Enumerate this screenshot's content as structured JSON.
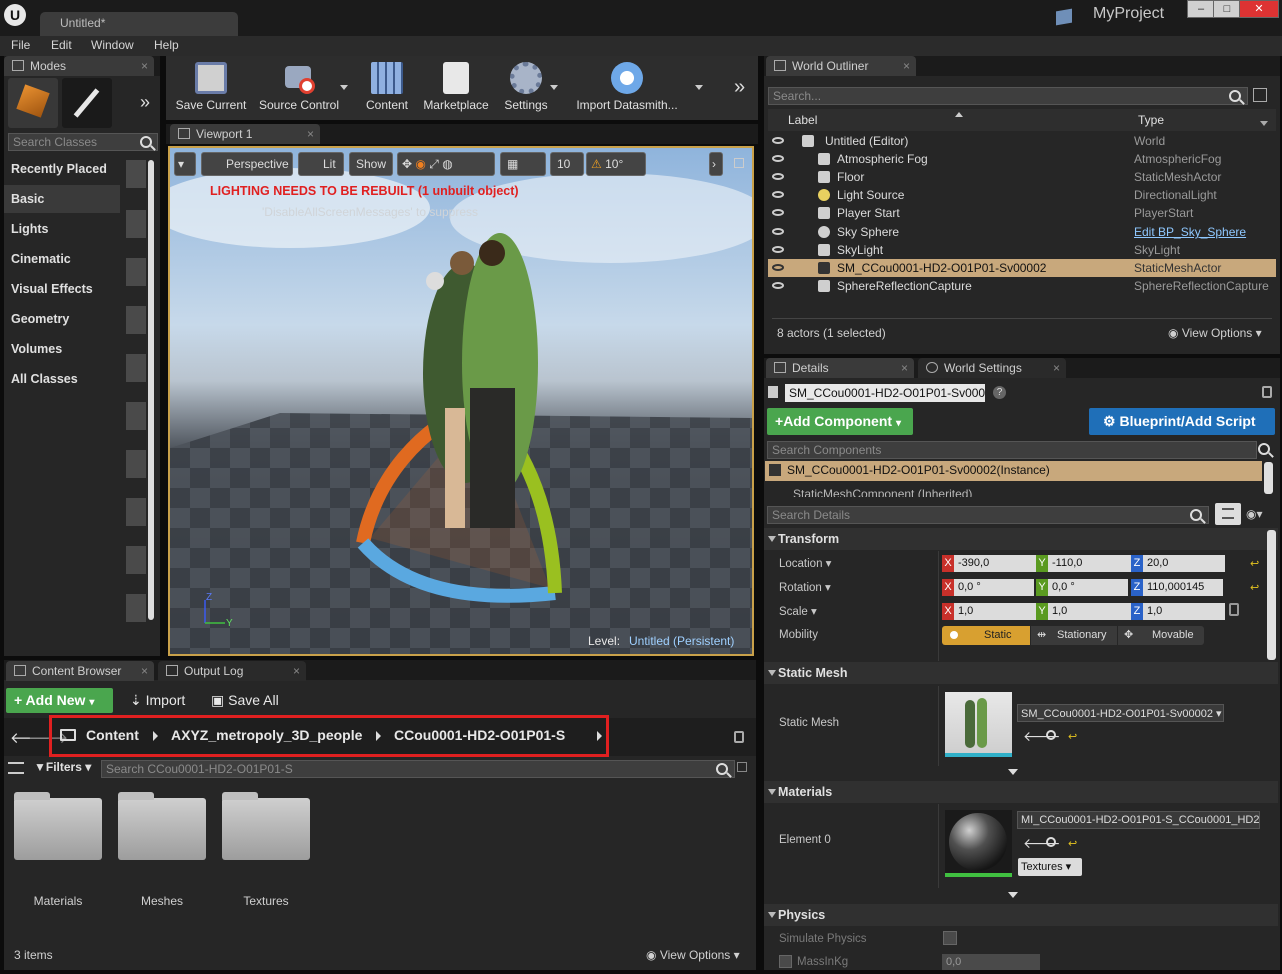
{
  "app": {
    "tab_title": "Untitled*",
    "project_name": "MyProject"
  },
  "menu": [
    "File",
    "Edit",
    "Window",
    "Help"
  ],
  "modes": {
    "tab": "Modes",
    "search_placeholder": "Search Classes",
    "categories": [
      "Recently Placed",
      "Basic",
      "Lights",
      "Cinematic",
      "Visual Effects",
      "Geometry",
      "Volumes",
      "All Classes"
    ],
    "selected": "Basic"
  },
  "toolbar": {
    "buttons": [
      "Save Current",
      "Source Control",
      "Content",
      "Marketplace",
      "Settings",
      "Import Datasmith..."
    ]
  },
  "viewport": {
    "tab": "Viewport 1",
    "perspective": "Perspective",
    "lit": "Lit",
    "show": "Show",
    "grid_snap": "10",
    "rot_snap": "10°",
    "warning": "LIGHTING NEEDS TO BE REBUILT (1 unbuilt object)",
    "warning_sub": "'DisableAllScreenMessages' to suppress",
    "level_label": "Level:",
    "level_name": "Untitled (Persistent)",
    "axis_z": "Z",
    "axis_y": "Y"
  },
  "outliner": {
    "tab": "World Outliner",
    "search_placeholder": "Search...",
    "col_label": "Label",
    "col_type": "Type",
    "root": {
      "label": "Untitled (Editor)",
      "type": "World"
    },
    "rows": [
      {
        "label": "Atmospheric Fog",
        "type": "AtmosphericFog"
      },
      {
        "label": "Floor",
        "type": "StaticMeshActor"
      },
      {
        "label": "Light Source",
        "type": "DirectionalLight"
      },
      {
        "label": "Player Start",
        "type": "PlayerStart"
      },
      {
        "label": "Sky Sphere",
        "type": "Edit BP_Sky_Sphere"
      },
      {
        "label": "SkyLight",
        "type": "SkyLight"
      },
      {
        "label": "SM_CCou0001-HD2-O01P01-Sv00002",
        "type": "StaticMeshActor"
      },
      {
        "label": "SphereReflectionCapture",
        "type": "SphereReflectionCapture"
      }
    ],
    "status": "8 actors (1 selected)",
    "view_options": "View Options"
  },
  "details": {
    "tab": "Details",
    "tab2": "World Settings",
    "actor_name": "SM_CCou0001-HD2-O01P01-Sv000",
    "add_component": "Add Component",
    "blueprint": "Blueprint/Add Script",
    "search_components": "Search Components",
    "instance": "SM_CCou0001-HD2-O01P01-Sv00002(Instance)",
    "component": "StaticMeshComponent (Inherited)",
    "search_details": "Search Details",
    "transform": {
      "title": "Transform",
      "location_label": "Location",
      "rotation_label": "Rotation",
      "scale_label": "Scale",
      "mobility_label": "Mobility",
      "location": [
        "-390,0",
        "-110,0",
        "20,0"
      ],
      "rotation": [
        "0,0 °",
        "0,0 °",
        "110,000145"
      ],
      "scale": [
        "1,0",
        "1,0",
        "1,0"
      ],
      "mobility": [
        "Static",
        "Stationary",
        "Movable"
      ],
      "axes": [
        "X",
        "Y",
        "Z"
      ]
    },
    "static_mesh": {
      "title": "Static Mesh",
      "label": "Static Mesh",
      "value": "SM_CCou0001-HD2-O01P01-Sv00002"
    },
    "materials": {
      "title": "Materials",
      "label": "Element 0",
      "value": "MI_CCou0001-HD2-O01P01-S_CCou0001_HD2",
      "textures": "Textures"
    },
    "physics": {
      "title": "Physics",
      "simulate": "Simulate Physics",
      "mass": "MassInKg",
      "mass_value": "0,0"
    }
  },
  "content_browser": {
    "tab": "Content Browser",
    "tab2": "Output Log",
    "add_new": "Add New",
    "import": "Import",
    "save_all": "Save All",
    "path": [
      "Content",
      "AXYZ_metropoly_3D_people",
      "CCou0001-HD2-O01P01-S"
    ],
    "filters": "Filters",
    "search_placeholder": "Search CCou0001-HD2-O01P01-S",
    "folders": [
      "Materials",
      "Meshes",
      "Textures"
    ],
    "count": "3 items",
    "view_options": "View Options"
  }
}
